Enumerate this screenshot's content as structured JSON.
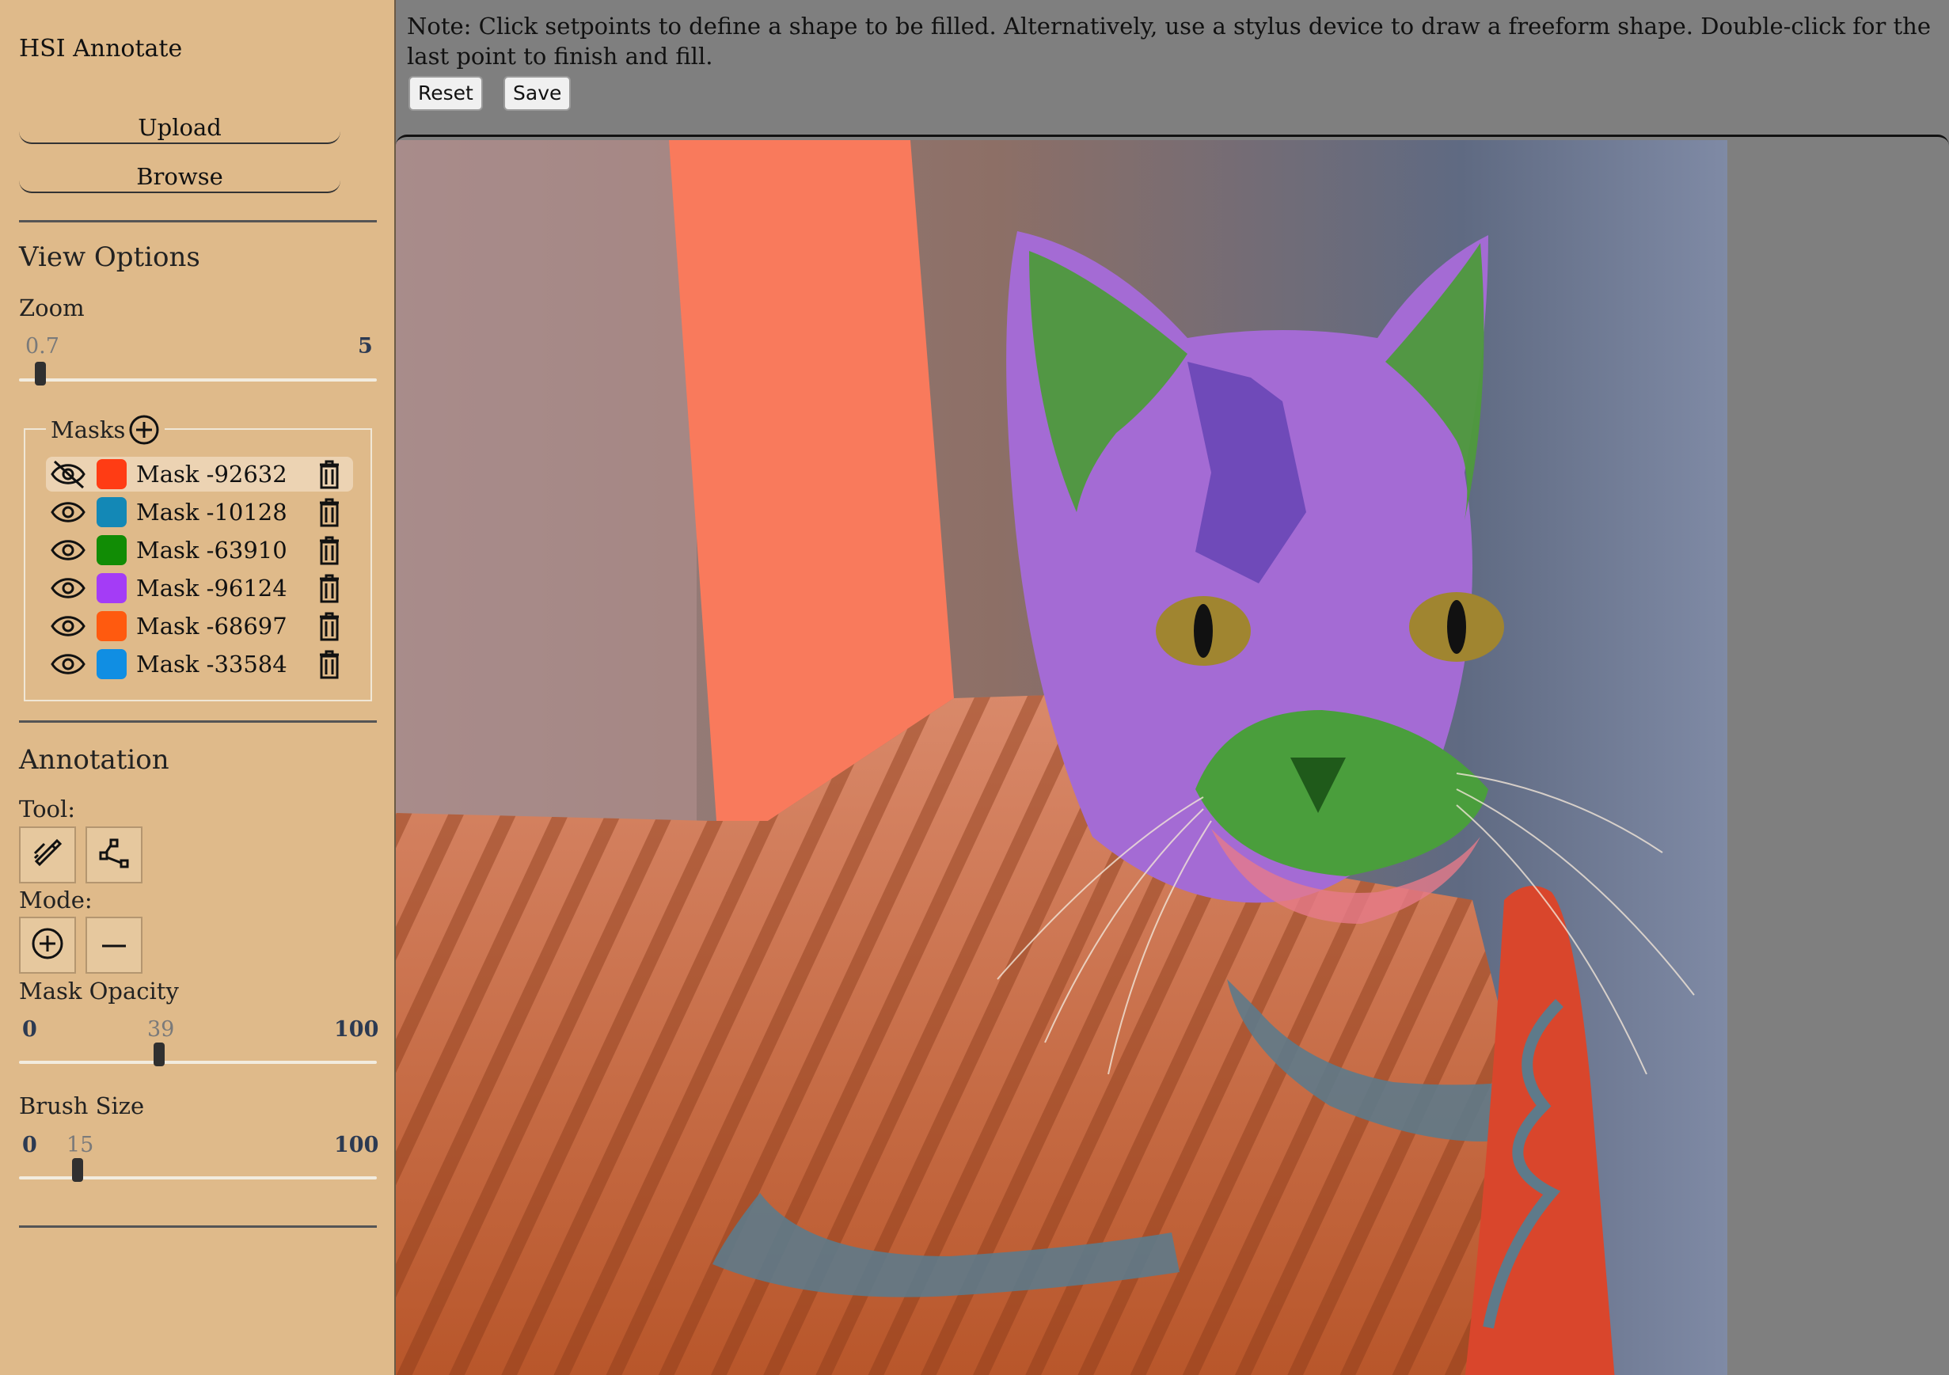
{
  "app": {
    "title": "HSI Annotate"
  },
  "sidebar": {
    "upload_label": "Upload",
    "browse_label": "Browse",
    "view_options": {
      "title": "View Options",
      "zoom_label": "Zoom",
      "zoom_value": "0.7",
      "zoom_max": "5",
      "zoom_fraction": 0.0
    },
    "masks": {
      "title": "Masks",
      "items": [
        {
          "name": "Mask -92632",
          "color": "#ff3c14",
          "visible": false,
          "selected": true
        },
        {
          "name": "Mask -10128",
          "color": "#1388b6",
          "visible": true,
          "selected": false
        },
        {
          "name": "Mask -63910",
          "color": "#118c05",
          "visible": true,
          "selected": false
        },
        {
          "name": "Mask -96124",
          "color": "#a43cf6",
          "visible": true,
          "selected": false
        },
        {
          "name": "Mask -68697",
          "color": "#ff5a0f",
          "visible": true,
          "selected": false
        },
        {
          "name": "Mask -33584",
          "color": "#108ee3",
          "visible": true,
          "selected": false
        }
      ]
    },
    "annotation": {
      "title": "Annotation",
      "tool_label": "Tool:",
      "mode_label": "Mode:",
      "opacity_label": "Mask Opacity",
      "opacity_min": "0",
      "opacity_value": "39",
      "opacity_max": "100",
      "brush_label": "Brush Size",
      "brush_min": "0",
      "brush_value": "15",
      "brush_max": "100"
    }
  },
  "main": {
    "note": "Note: Click setpoints to define a shape to be filled. Alternatively, use a stylus device to draw a freeform shape. Double-click for the last point to finish and fill.",
    "reset_label": "Reset",
    "save_label": "Save"
  },
  "icons": {
    "eye": "eye-icon",
    "eye_off": "eye-off-icon",
    "trash": "trash-icon",
    "add": "plus-circle-icon",
    "brush": "brush-tool-icon",
    "polygon": "polygon-tool-icon",
    "mode_add": "plus-circle-icon",
    "mode_subtract": "minus-icon"
  }
}
